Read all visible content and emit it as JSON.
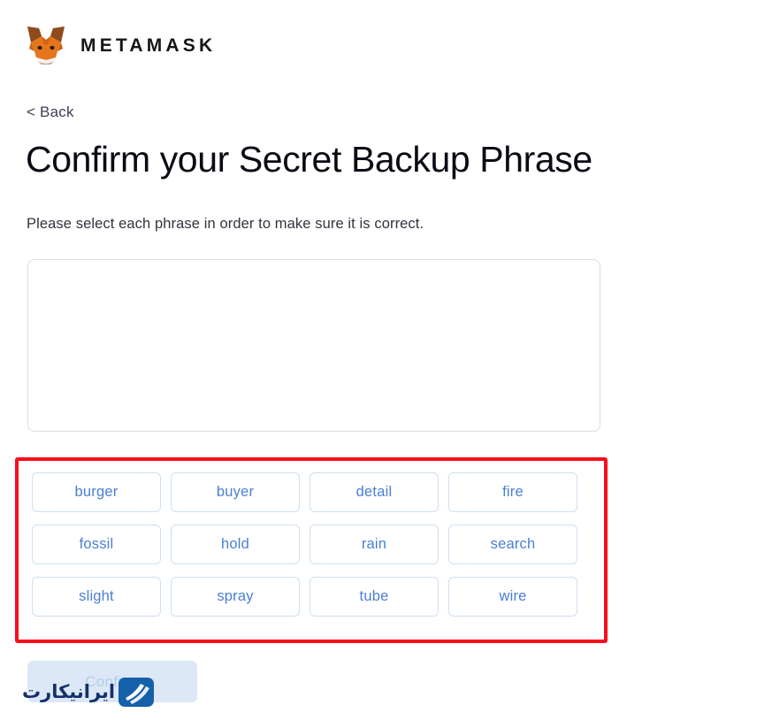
{
  "brand": {
    "name": "METAMASK",
    "logo_icon": "metamask-fox-icon",
    "fox_colors": {
      "orange_light": "#e2761b",
      "orange_mid": "#e4761b",
      "orange_dark": "#cd6116",
      "brown": "#763d16",
      "white": "#f6f1eb",
      "gray": "#c0ad9e"
    }
  },
  "navigation": {
    "back_label": "< Back",
    "back_icon": "chevron-left-icon"
  },
  "header": {
    "title": "Confirm your Secret Backup Phrase",
    "subtitle": "Please select each phrase in order to make sure it is correct."
  },
  "drop_zone": {
    "selected_words": [],
    "placeholder": ""
  },
  "word_bank": {
    "words": [
      "burger",
      "buyer",
      "detail",
      "fire",
      "fossil",
      "hold",
      "rain",
      "search",
      "slight",
      "spray",
      "tube",
      "wire"
    ]
  },
  "annotation": {
    "highlight_color": "#fc0d1b",
    "target": "word-bank"
  },
  "actions": {
    "confirm_label": "Confirm",
    "confirm_disabled": true
  },
  "watermark": {
    "text": "ایرانیکارت",
    "mark_icon": "iranicard-logo-icon",
    "mark_color": "#1560a8",
    "text_color": "#15306b"
  },
  "colors": {
    "chip_border": "#cfdff2",
    "chip_text": "#4a7fd4",
    "drop_zone_border": "#dcdcdc",
    "title_text": "#0b0b14",
    "confirm_bg": "#dde8f6",
    "confirm_text": "#b3cdea"
  }
}
